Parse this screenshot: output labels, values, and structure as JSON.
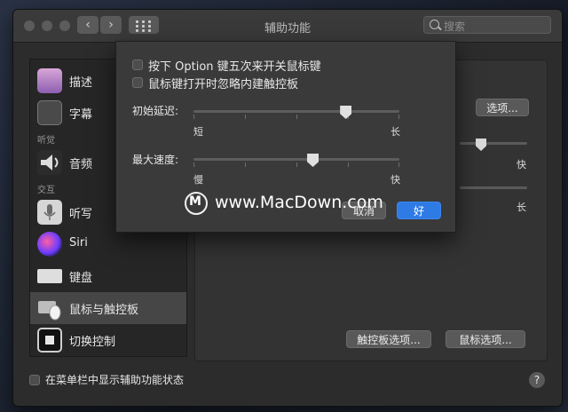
{
  "window": {
    "title": "辅助功能",
    "search_placeholder": "搜索"
  },
  "nav": {
    "back": "‹",
    "forward": "›"
  },
  "sidebar": {
    "items": [
      {
        "label": "描述",
        "icon": "display-description-icon"
      },
      {
        "label": "字幕",
        "icon": "captions-icon"
      },
      {
        "label": "音频",
        "icon": "speaker-icon"
      },
      {
        "label": "听写",
        "icon": "microphone-icon"
      },
      {
        "label": "Siri",
        "icon": "siri-icon"
      },
      {
        "label": "键盘",
        "icon": "keyboard-icon"
      },
      {
        "label": "鼠标与触控板",
        "icon": "mouse-trackpad-icon",
        "selected": true
      },
      {
        "label": "切换控制",
        "icon": "switch-control-icon"
      }
    ],
    "sections": {
      "hearing": "听觉",
      "interaction": "交互"
    }
  },
  "background": {
    "options_button": "选项...",
    "slider1_max": "快",
    "slider2_max": "长",
    "trackpad_options_button": "触控板选项...",
    "mouse_options_button": "鼠标选项..."
  },
  "sheet": {
    "checkbox1": {
      "label": "按下 Option 键五次来开关鼠标键",
      "checked": false
    },
    "checkbox2": {
      "label": "鼠标键打开时忽略内建触控板",
      "checked": false
    },
    "initial_delay": {
      "label": "初始延迟:",
      "min_label": "短",
      "max_label": "长",
      "value": 0.74
    },
    "max_speed": {
      "label": "最大速度:",
      "min_label": "慢",
      "max_label": "快",
      "value": 0.58
    },
    "cancel_button": "取消",
    "ok_button": "好"
  },
  "footer": {
    "show_status_label": "在菜单栏中显示辅助功能状态",
    "help": "?"
  },
  "watermark": {
    "text": "www.MacDown.com"
  },
  "colors": {
    "accent": "#2e7be6"
  }
}
